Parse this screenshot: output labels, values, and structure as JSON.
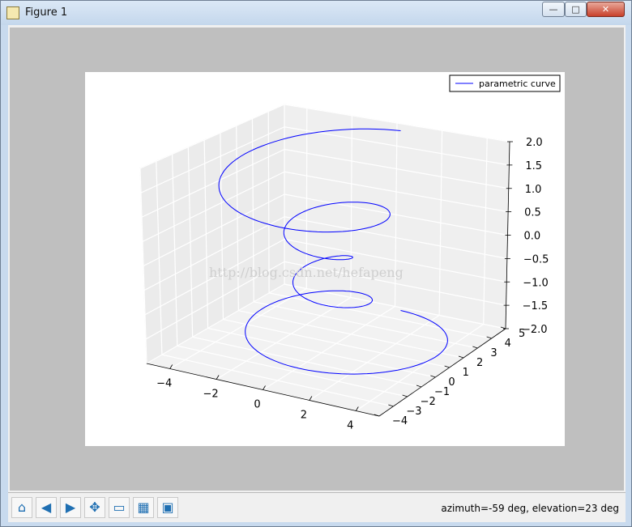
{
  "window": {
    "title": "Figure 1",
    "controls": {
      "minimize": "—",
      "maximize": "□",
      "close": "✕"
    }
  },
  "toolbar": {
    "buttons": [
      {
        "name": "home",
        "icon": "home-icon",
        "glyph": "⌂"
      },
      {
        "name": "back",
        "icon": "back-arrow-icon",
        "glyph": "◀"
      },
      {
        "name": "forward",
        "icon": "forward-arrow-icon",
        "glyph": "▶"
      },
      {
        "name": "pan",
        "icon": "pan-move-icon",
        "glyph": "✥"
      },
      {
        "name": "zoom",
        "icon": "zoom-rect-icon",
        "glyph": "▭"
      },
      {
        "name": "subplots",
        "icon": "subplots-config-icon",
        "glyph": "▦"
      },
      {
        "name": "save",
        "icon": "save-floppy-icon",
        "glyph": "▣"
      }
    ],
    "status": "azimuth=-59 deg, elevation=23 deg"
  },
  "watermark": "http://blog.csdn.net/hefapeng",
  "colors": {
    "line": "#0000ff",
    "pane": "#ebebeb",
    "plot_bg": "#bfbfbf",
    "figure_bg": "#ffffff"
  },
  "chart_data": {
    "type": "line",
    "projection": "3d",
    "view": {
      "azimuth": -59,
      "elevation": 23
    },
    "legend": {
      "entries": [
        "parametric curve"
      ],
      "placement": "top-right"
    },
    "xticks": [
      "−4",
      "−2",
      "0",
      "2",
      "4"
    ],
    "yticks": [
      "−4",
      "−3",
      "−2",
      "−1",
      "0",
      "1",
      "2",
      "3",
      "4",
      "5"
    ],
    "zticks": [
      "2.0",
      "1.5",
      "1.0",
      "0.5",
      "0.0",
      "−0.5",
      "−1.0",
      "−1.5",
      "−2.0"
    ],
    "xlim": [
      -5,
      5
    ],
    "ylim": [
      -4,
      5
    ],
    "zlim": [
      -2,
      2
    ],
    "grid": true,
    "series": [
      {
        "name": "parametric curve",
        "param": "theta in [-4*pi, 4*pi], z in [-2, 2], r = z^2 + 1, x = r*sin(theta), y = r*cos(theta)",
        "points": 100
      }
    ]
  }
}
